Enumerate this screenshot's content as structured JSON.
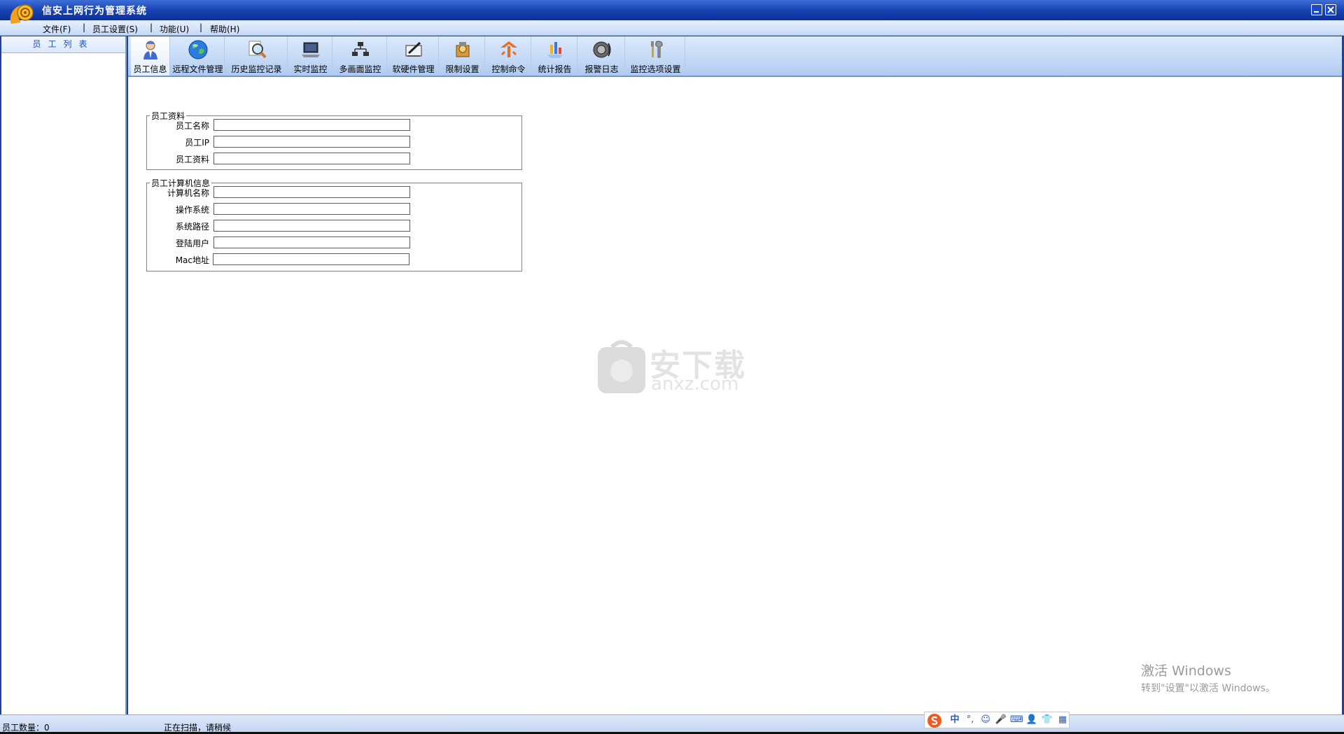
{
  "window": {
    "title": "信安上网行为管理系统",
    "controls": {
      "minimize": "minimize",
      "close": "close"
    }
  },
  "menu": {
    "items": [
      {
        "label": "文件(F)"
      },
      {
        "label": "员工设置(S)"
      },
      {
        "label": "功能(U)"
      },
      {
        "label": "帮助(H)"
      }
    ],
    "separator": "|"
  },
  "sidebar": {
    "header": "员工列表"
  },
  "toolbar": {
    "items": [
      {
        "label": "员工信息",
        "icon": "employee-icon",
        "active": true
      },
      {
        "label": "远程文件管理",
        "icon": "globe-icon"
      },
      {
        "label": "历史监控记录",
        "icon": "magnifier-icon"
      },
      {
        "label": "实时监控",
        "icon": "laptop-icon"
      },
      {
        "label": "多画面监控",
        "icon": "network-icon"
      },
      {
        "label": "软硬件管理",
        "icon": "settings-pen-icon"
      },
      {
        "label": "限制设置",
        "icon": "lock-box-icon"
      },
      {
        "label": "控制命令",
        "icon": "arrows-icon"
      },
      {
        "label": "统计报告",
        "icon": "report-icon"
      },
      {
        "label": "报警日志",
        "icon": "speaker-icon"
      },
      {
        "label": "监控选项设置",
        "icon": "tools-icon"
      }
    ]
  },
  "employee_info": {
    "legend": "员工资料",
    "fields": [
      {
        "label": "员工名称",
        "value": ""
      },
      {
        "label": "员工IP",
        "value": ""
      },
      {
        "label": "员工资料",
        "value": ""
      }
    ]
  },
  "computer_info": {
    "legend": "员工计算机信息",
    "fields": [
      {
        "label": "计算机名称",
        "value": ""
      },
      {
        "label": "操作系统",
        "value": ""
      },
      {
        "label": "系统路径",
        "value": ""
      },
      {
        "label": "登陆用户",
        "value": ""
      },
      {
        "label": "Mac地址",
        "value": ""
      }
    ]
  },
  "watermark": {
    "cn": "安下载",
    "en": "anxz.com"
  },
  "activation": {
    "line1": "激活 Windows",
    "line2": "转到\"设置\"以激活 Windows。"
  },
  "status": {
    "employee_count": "员工数量：0",
    "scanning": "正在扫描，请稍候"
  },
  "ime": {
    "items": [
      "中",
      "°,",
      "☺",
      "🎤",
      "⌨",
      "👤",
      "👕",
      "▦"
    ]
  },
  "colors": {
    "title_bar": "#1c46b7",
    "menu_bar": "#d6e5f9",
    "toolbar": "#c4d9f6",
    "sidebar_header_text": "#1f4fb1"
  }
}
